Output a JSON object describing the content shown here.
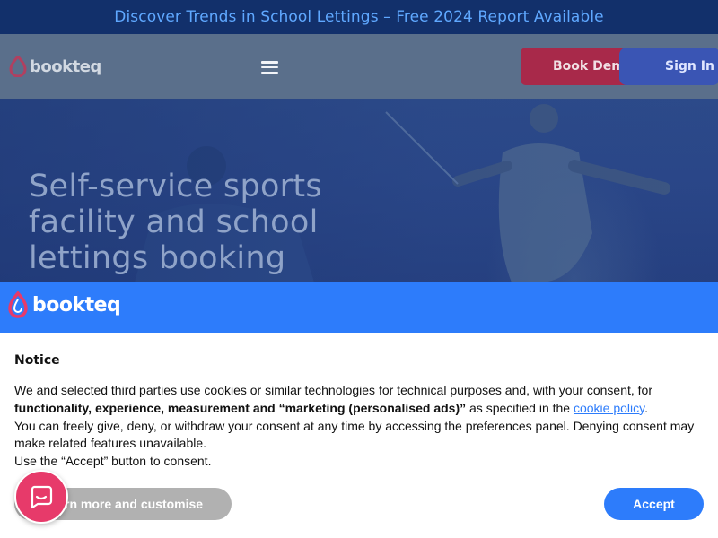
{
  "announcement": {
    "text": "Discover Trends in School Lettings – Free 2024 Report Available"
  },
  "header": {
    "logo_text": "bookteq",
    "book_demo_label": "Book Demo",
    "sign_in_label": "Sign In"
  },
  "hero": {
    "title": "Self-service sports facility and school lettings booking"
  },
  "cookie_notice": {
    "logo_text": "bookteq",
    "title": "Notice",
    "text_part1": "We and selected third parties use cookies or similar technologies for technical purposes and, with your consent, for ",
    "text_bold": "functionality, experience, measurement and “marketing (personalised ads)”",
    "text_part2": " as specified in the ",
    "cookie_policy_link": "cookie policy",
    "text_part3": ".",
    "text_line2": "You can freely give, deny, or withdraw your consent at any time by accessing the preferences panel. Denying consent may make related features unavailable.",
    "text_line3": "Use the “Accept” button to consent.",
    "learn_more_label": "Learn more and customise",
    "accept_label": "Accept"
  },
  "icons": {
    "logo": "bookteq-drop-icon",
    "menu": "hamburger-menu-icon",
    "chat": "chat-bubble-icon"
  },
  "colors": {
    "brand_blue": "#2d7cfb",
    "brand_pink": "#e73a6a",
    "announcement_bg": "#12306b"
  }
}
